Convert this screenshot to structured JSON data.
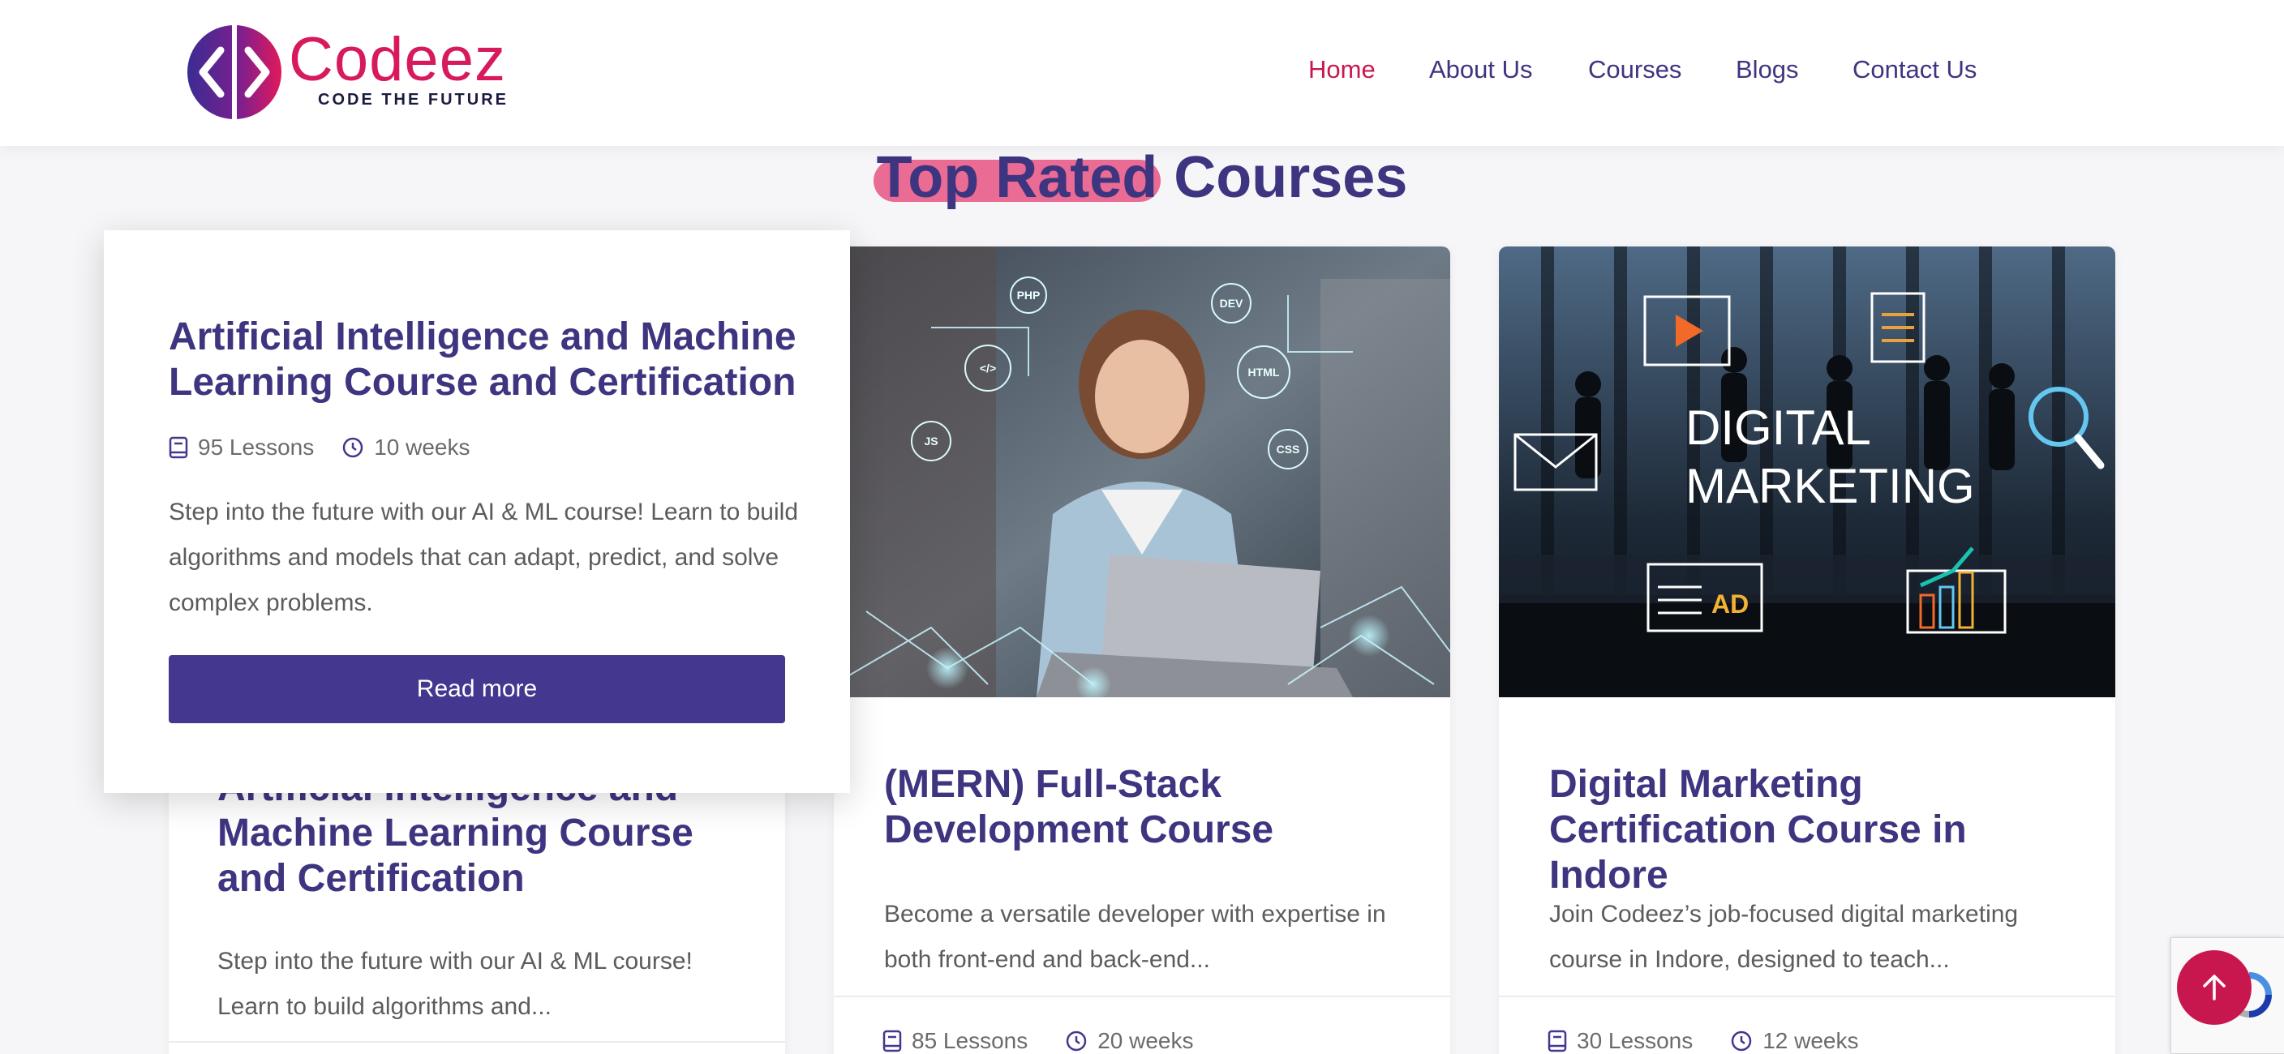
{
  "brand": {
    "name": "Codeez",
    "tagline": "CODE THE FUTURE",
    "colors": {
      "primary": "#3e3580",
      "accent": "#c8174f",
      "highlight": "#ea6b93"
    }
  },
  "nav": {
    "items": [
      {
        "label": "Home",
        "active": true
      },
      {
        "label": "About Us",
        "active": false
      },
      {
        "label": "Courses",
        "active": false
      },
      {
        "label": "Blogs",
        "active": false
      },
      {
        "label": "Contact Us",
        "active": false
      }
    ]
  },
  "section": {
    "title_highlight": "Top Rated",
    "title_rest": "Courses"
  },
  "overlay": {
    "title": "Artificial Intelligence and Machine Learning Course and Certification",
    "lessons": "95 Lessons",
    "duration": "10 weeks",
    "description": "Step into the future with our AI & ML course! Learn to build algorithms and models that can adapt, predict, and solve complex problems.",
    "button_label": "Read more"
  },
  "cards": [
    {
      "title": "Artificial Intelligence and Machine Learning Course and Certification",
      "description": "Step into the future with our AI & ML course! Learn to build algorithms and...",
      "lessons": "",
      "duration": ""
    },
    {
      "title": "(MERN) Full-Stack Development Course",
      "description": "Become a versatile developer with expertise in both front-end and back-end...",
      "lessons": "85 Lessons",
      "duration": "20 weeks",
      "image": {
        "labels": [
          "PHP",
          "DEV",
          "</>",
          "HTML",
          "JS",
          "CSS"
        ]
      }
    },
    {
      "title": "Digital Marketing Certification Course in Indore",
      "description": "Join Codeez’s job-focused digital marketing course in Indore, designed to teach...",
      "lessons": "30 Lessons",
      "duration": "12 weeks",
      "image": {
        "headline_1": "DIGITAL",
        "headline_2": "MARKETING",
        "ad_label": "AD"
      }
    }
  ]
}
